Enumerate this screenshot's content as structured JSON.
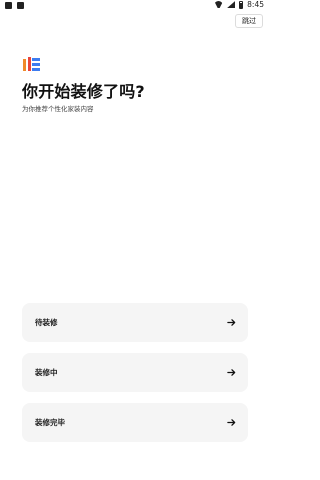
{
  "status_bar": {
    "time": "8:45",
    "icons": [
      "notification-icon",
      "notification-icon-2",
      "wifi-icon",
      "signal-icon",
      "battery-icon"
    ]
  },
  "header": {
    "skip_label": "跳过"
  },
  "main": {
    "title": "你开始装修了吗?",
    "subtitle": "为你推荐个性化家装内容",
    "options": [
      {
        "label": "待装修",
        "icon": "arrow-right-icon"
      },
      {
        "label": "装修中",
        "icon": "arrow-right-icon"
      },
      {
        "label": "装修完毕",
        "icon": "arrow-right-icon"
      }
    ]
  },
  "colors": {
    "option_bg": "#f5f5f5",
    "logo_orange": "#f08a2a",
    "logo_red": "#e8453c",
    "logo_blue": "#3d7cf0"
  }
}
